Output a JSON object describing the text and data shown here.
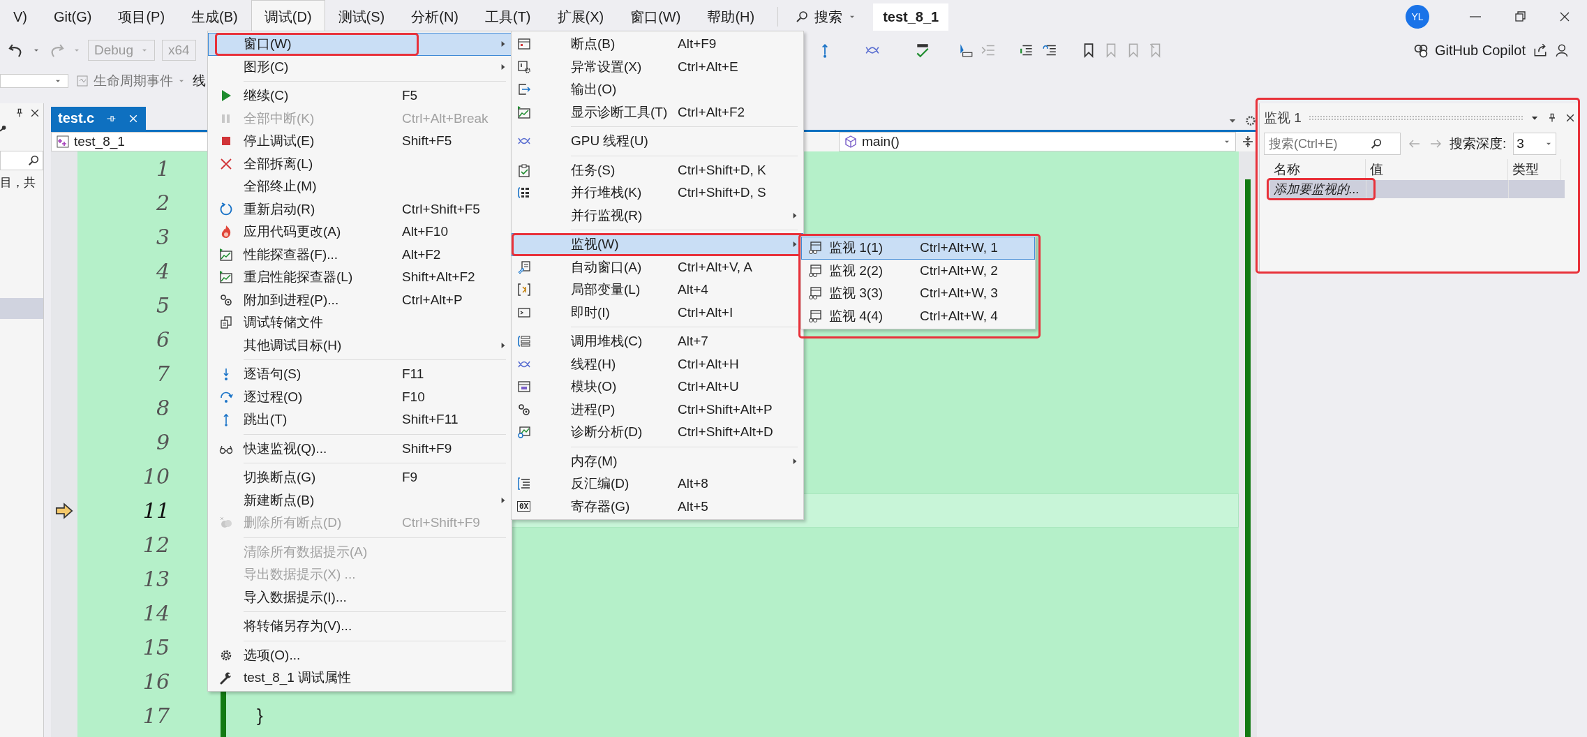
{
  "menubar": {
    "items": [
      {
        "label": "V)",
        "selected": false
      },
      {
        "label": "Git(G)",
        "selected": false
      },
      {
        "label": "项目(P)",
        "selected": false
      },
      {
        "label": "生成(B)",
        "selected": false
      },
      {
        "label": "调试(D)",
        "selected": true
      },
      {
        "label": "测试(S)",
        "selected": false
      },
      {
        "label": "分析(N)",
        "selected": false
      },
      {
        "label": "工具(T)",
        "selected": false
      },
      {
        "label": "扩展(X)",
        "selected": false
      },
      {
        "label": "窗口(W)",
        "selected": false
      },
      {
        "label": "帮助(H)",
        "selected": false
      }
    ],
    "search": "搜索",
    "solution": "test_8_1",
    "account": "YL"
  },
  "toolbar": {
    "configuration": "Debug",
    "platform": "x64",
    "copilot": "GitHub Copilot",
    "lifecycle": "生命周期事件",
    "cut_label": "线"
  },
  "left_panel": {
    "text": "目，共"
  },
  "editor": {
    "tab": "test.c",
    "scope": "test_8_1",
    "function": "main()",
    "lines": [
      {
        "number": "1",
        "current": false
      },
      {
        "number": "2",
        "current": false
      },
      {
        "number": "3",
        "current": false
      },
      {
        "number": "4",
        "current": false
      },
      {
        "number": "5",
        "current": false
      },
      {
        "number": "6",
        "current": false
      },
      {
        "number": "7",
        "current": false
      },
      {
        "number": "8",
        "current": false
      },
      {
        "number": "9",
        "current": false
      },
      {
        "number": "10",
        "current": false
      },
      {
        "number": "11",
        "current": true
      },
      {
        "number": "12",
        "current": false
      },
      {
        "number": "13",
        "current": false
      },
      {
        "number": "14",
        "current": false
      },
      {
        "number": "15",
        "current": false
      },
      {
        "number": "16",
        "current": false
      },
      {
        "number": "17",
        "current": false,
        "code": "}"
      }
    ]
  },
  "debug_menu": {
    "items": [
      {
        "kind": "item",
        "label": "窗口(W)",
        "submenu": true,
        "selected": true,
        "disabled": false,
        "highlighted": true
      },
      {
        "kind": "item",
        "label": "图形(C)",
        "submenu": true,
        "selected": false,
        "disabled": false,
        "highlighted": false
      },
      {
        "kind": "separator"
      },
      {
        "kind": "item",
        "label": "继续(C)",
        "shortcut": "F5",
        "selected": false,
        "disabled": false,
        "highlighted": false
      },
      {
        "kind": "item",
        "label": "全部中断(K)",
        "shortcut": "Ctrl+Alt+Break",
        "selected": false,
        "disabled": true,
        "highlighted": false
      },
      {
        "kind": "item",
        "label": "停止调试(E)",
        "shortcut": "Shift+F5",
        "selected": false,
        "disabled": false,
        "highlighted": false
      },
      {
        "kind": "item",
        "label": "全部拆离(L)",
        "selected": false,
        "disabled": false,
        "highlighted": false
      },
      {
        "kind": "item",
        "label": "全部终止(M)",
        "selected": false,
        "disabled": false,
        "highlighted": false
      },
      {
        "kind": "item",
        "label": "重新启动(R)",
        "shortcut": "Ctrl+Shift+F5",
        "selected": false,
        "disabled": false,
        "highlighted": false
      },
      {
        "kind": "item",
        "label": "应用代码更改(A)",
        "shortcut": "Alt+F10",
        "selected": false,
        "disabled": false,
        "highlighted": false
      },
      {
        "kind": "item",
        "label": "性能探查器(F)...",
        "shortcut": "Alt+F2",
        "selected": false,
        "disabled": false,
        "highlighted": false
      },
      {
        "kind": "item",
        "label": "重启性能探查器(L)",
        "shortcut": "Shift+Alt+F2",
        "selected": false,
        "disabled": false,
        "highlighted": false
      },
      {
        "kind": "item",
        "label": "附加到进程(P)...",
        "shortcut": "Ctrl+Alt+P",
        "selected": false,
        "disabled": false,
        "highlighted": false
      },
      {
        "kind": "item",
        "label": "调试转储文件",
        "selected": false,
        "disabled": false,
        "highlighted": false
      },
      {
        "kind": "item",
        "label": "其他调试目标(H)",
        "submenu": true,
        "selected": false,
        "disabled": false,
        "highlighted": false
      },
      {
        "kind": "separator"
      },
      {
        "kind": "item",
        "label": "逐语句(S)",
        "shortcut": "F11",
        "selected": false,
        "disabled": false,
        "highlighted": false
      },
      {
        "kind": "item",
        "label": "逐过程(O)",
        "shortcut": "F10",
        "selected": false,
        "disabled": false,
        "highlighted": false
      },
      {
        "kind": "item",
        "label": "跳出(T)",
        "shortcut": "Shift+F11",
        "selected": false,
        "disabled": false,
        "highlighted": false
      },
      {
        "kind": "separator"
      },
      {
        "kind": "item",
        "label": "快速监视(Q)...",
        "shortcut": "Shift+F9",
        "selected": false,
        "disabled": false,
        "highlighted": false
      },
      {
        "kind": "separator"
      },
      {
        "kind": "item",
        "label": "切换断点(G)",
        "shortcut": "F9",
        "selected": false,
        "disabled": false,
        "highlighted": false
      },
      {
        "kind": "item",
        "label": "新建断点(B)",
        "submenu": true,
        "selected": false,
        "disabled": false,
        "highlighted": false
      },
      {
        "kind": "item",
        "label": "删除所有断点(D)",
        "shortcut": "Ctrl+Shift+F9",
        "selected": false,
        "disabled": true,
        "highlighted": false
      },
      {
        "kind": "separator"
      },
      {
        "kind": "item",
        "label": "清除所有数据提示(A)",
        "selected": false,
        "disabled": true,
        "highlighted": false
      },
      {
        "kind": "item",
        "label": "导出数据提示(X) ...",
        "selected": false,
        "disabled": true,
        "highlighted": false
      },
      {
        "kind": "item",
        "label": "导入数据提示(I)...",
        "selected": false,
        "disabled": false,
        "highlighted": false
      },
      {
        "kind": "separator"
      },
      {
        "kind": "item",
        "label": "将转储另存为(V)...",
        "selected": false,
        "disabled": false,
        "highlighted": false
      },
      {
        "kind": "separator"
      },
      {
        "kind": "item",
        "label": "选项(O)...",
        "selected": false,
        "disabled": false,
        "highlighted": false
      },
      {
        "kind": "item",
        "label": "test_8_1 调试属性",
        "selected": false,
        "disabled": false,
        "highlighted": false
      }
    ]
  },
  "window_menu": {
    "items": [
      {
        "kind": "item",
        "label": "断点(B)",
        "shortcut": "Alt+F9",
        "selected": false,
        "highlighted": false
      },
      {
        "kind": "item",
        "label": "异常设置(X)",
        "shortcut": "Ctrl+Alt+E",
        "selected": false,
        "highlighted": false
      },
      {
        "kind": "item",
        "label": "输出(O)",
        "selected": false,
        "highlighted": false
      },
      {
        "kind": "item",
        "label": "显示诊断工具(T)",
        "shortcut": "Ctrl+Alt+F2",
        "selected": false,
        "highlighted": false
      },
      {
        "kind": "separator"
      },
      {
        "kind": "item",
        "label": "GPU 线程(U)",
        "selected": false,
        "highlighted": false
      },
      {
        "kind": "separator"
      },
      {
        "kind": "item",
        "label": "任务(S)",
        "shortcut": "Ctrl+Shift+D, K",
        "selected": false,
        "highlighted": false
      },
      {
        "kind": "item",
        "label": "并行堆栈(K)",
        "shortcut": "Ctrl+Shift+D, S",
        "selected": false,
        "highlighted": false
      },
      {
        "kind": "item",
        "label": "并行监视(R)",
        "submenu": true,
        "selected": false,
        "highlighted": false
      },
      {
        "kind": "separator"
      },
      {
        "kind": "item",
        "label": "监视(W)",
        "submenu": true,
        "selected": true,
        "highlighted": true
      },
      {
        "kind": "item",
        "label": "自动窗口(A)",
        "shortcut": "Ctrl+Alt+V, A",
        "selected": false,
        "highlighted": false
      },
      {
        "kind": "item",
        "label": "局部变量(L)",
        "shortcut": "Alt+4",
        "selected": false,
        "highlighted": false
      },
      {
        "kind": "item",
        "label": "即时(I)",
        "shortcut": "Ctrl+Alt+I",
        "selected": false,
        "highlighted": false
      },
      {
        "kind": "separator"
      },
      {
        "kind": "item",
        "label": "调用堆栈(C)",
        "shortcut": "Alt+7",
        "selected": false,
        "highlighted": false
      },
      {
        "kind": "item",
        "label": "线程(H)",
        "shortcut": "Ctrl+Alt+H",
        "selected": false,
        "highlighted": false
      },
      {
        "kind": "item",
        "label": "模块(O)",
        "shortcut": "Ctrl+Alt+U",
        "selected": false,
        "highlighted": false
      },
      {
        "kind": "item",
        "label": "进程(P)",
        "shortcut": "Ctrl+Shift+Alt+P",
        "selected": false,
        "highlighted": false
      },
      {
        "kind": "item",
        "label": "诊断分析(D)",
        "shortcut": "Ctrl+Shift+Alt+D",
        "selected": false,
        "highlighted": false
      },
      {
        "kind": "separator"
      },
      {
        "kind": "item",
        "label": "内存(M)",
        "submenu": true,
        "selected": false,
        "highlighted": false
      },
      {
        "kind": "item",
        "label": "反汇编(D)",
        "shortcut": "Alt+8",
        "selected": false,
        "highlighted": false
      },
      {
        "kind": "item",
        "label": "寄存器(G)",
        "shortcut": "Alt+5",
        "icon_text": "0X",
        "selected": false,
        "highlighted": false
      }
    ]
  },
  "watch_menu": {
    "highlighted": true,
    "items": [
      {
        "kind": "item",
        "label": "监视 1(1)",
        "shortcut": "Ctrl+Alt+W, 1",
        "selected": true,
        "highlighted": false
      },
      {
        "kind": "item",
        "label": "监视 2(2)",
        "shortcut": "Ctrl+Alt+W, 2",
        "selected": false,
        "highlighted": false
      },
      {
        "kind": "item",
        "label": "监视 3(3)",
        "shortcut": "Ctrl+Alt+W, 3",
        "selected": false,
        "highlighted": false
      },
      {
        "kind": "item",
        "label": "监视 4(4)",
        "shortcut": "Ctrl+Alt+W, 4",
        "selected": false,
        "highlighted": false
      }
    ]
  },
  "watch_panel": {
    "title": "监视 1",
    "highlighted": true,
    "search": {
      "placeholder": "搜索(Ctrl+E)"
    },
    "depth_label": "搜索深度:",
    "depth": "3",
    "columns": [
      "名称",
      "值",
      "类型"
    ],
    "rows": [
      {
        "name": "添加要监视的...",
        "highlighted": true
      }
    ]
  }
}
